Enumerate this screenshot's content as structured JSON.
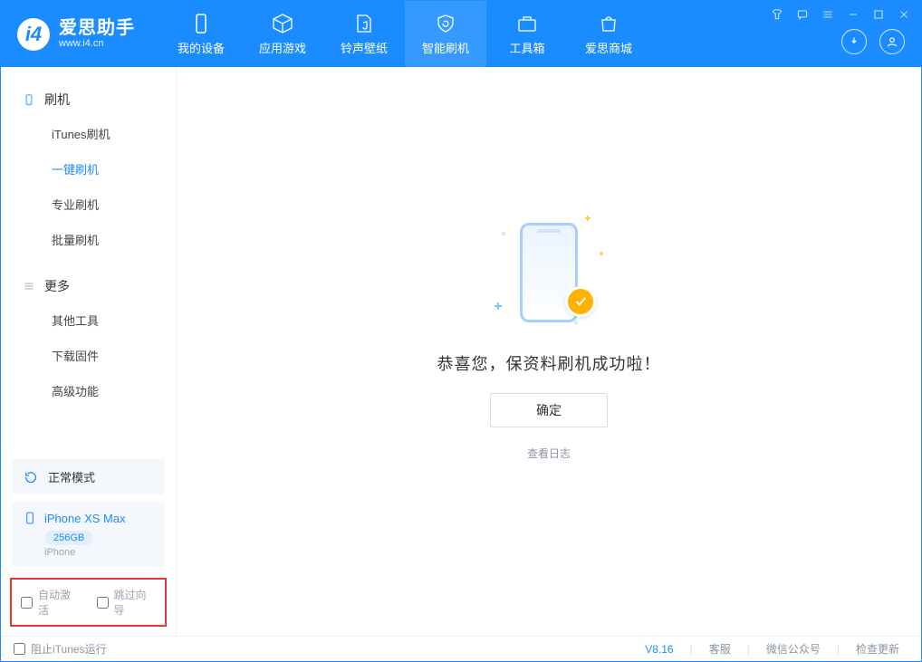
{
  "app": {
    "title": "爱思助手",
    "subtitle": "www.i4.cn"
  },
  "tabs": [
    {
      "label": "我的设备"
    },
    {
      "label": "应用游戏"
    },
    {
      "label": "铃声壁纸"
    },
    {
      "label": "智能刷机"
    },
    {
      "label": "工具箱"
    },
    {
      "label": "爱思商城"
    }
  ],
  "sidebar": {
    "group1_title": "刷机",
    "group1_items": [
      "iTunes刷机",
      "一键刷机",
      "专业刷机",
      "批量刷机"
    ],
    "group2_title": "更多",
    "group2_items": [
      "其他工具",
      "下载固件",
      "高级功能"
    ]
  },
  "mode": {
    "label": "正常模式"
  },
  "device": {
    "name": "iPhone XS Max",
    "capacity": "256GB",
    "type": "iPhone"
  },
  "options": {
    "auto_activate": "自动激活",
    "skip_guide": "跳过向导"
  },
  "main": {
    "success_text": "恭喜您，保资料刷机成功啦！",
    "ok_button": "确定",
    "view_log": "查看日志"
  },
  "footer": {
    "block_itunes": "阻止iTunes运行",
    "version": "V8.16",
    "links": [
      "客服",
      "微信公众号",
      "检查更新"
    ]
  }
}
